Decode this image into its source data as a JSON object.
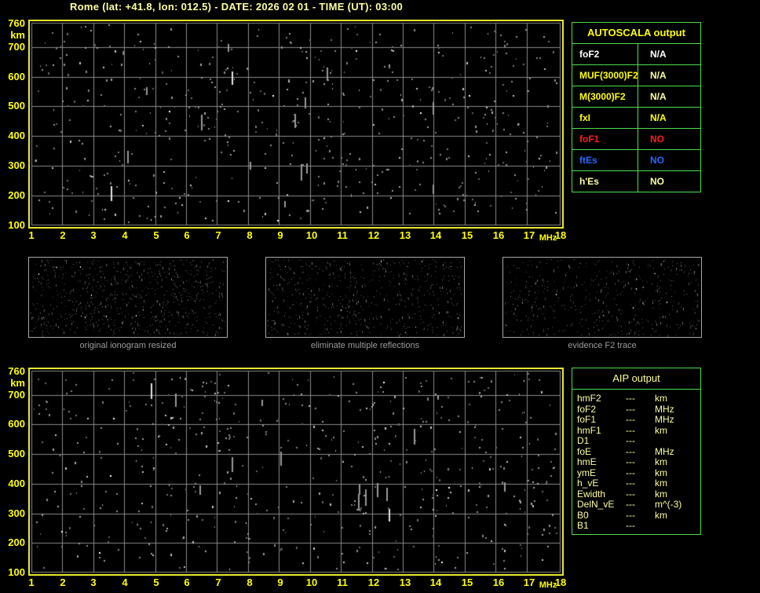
{
  "title": "Rome (lat: +41.8, lon: 012.5) - DATE: 2026 02 01 - TIME (UT): 03:00",
  "colors": {
    "background": "#000000",
    "title_text": "#ffffa0",
    "axis_frame": "#e8e832",
    "axis_label": "#ffff00",
    "grid": "#8a8a8a",
    "table_border": "#4ade4a",
    "white": "#ffffff",
    "yellow": "#ffff00",
    "pale": "#ffff9e",
    "red": "#ff1c1c",
    "blue": "#1e6aff",
    "caption_gray": "#9c9c9c"
  },
  "plots": {
    "x_ticks": [
      "1",
      "2",
      "3",
      "4",
      "5",
      "6",
      "7",
      "8",
      "9",
      "10",
      "11",
      "12",
      "13",
      "14",
      "15",
      "16",
      "17",
      "18"
    ],
    "x_unit": "MHz",
    "y_ticks": [
      "700",
      "600",
      "500",
      "400",
      "300",
      "200",
      "100"
    ],
    "y_top_tick": "760",
    "y_unit": "km"
  },
  "chart_data": [
    {
      "type": "scatter",
      "title": "ionogram (top, autoscaled input)",
      "xlabel": "MHz",
      "ylabel": "km",
      "xlim": [
        1,
        18
      ],
      "xticks": [
        1,
        2,
        3,
        4,
        5,
        6,
        7,
        8,
        9,
        10,
        11,
        12,
        13,
        14,
        15,
        16,
        17,
        18
      ],
      "ylim": [
        100,
        760
      ],
      "yticks": [
        100,
        200,
        300,
        400,
        500,
        600,
        700,
        760
      ],
      "grid": true,
      "series": [],
      "note": "only scattered background noise echoes; no ionospheric trace detected (all AUTOSCALA outputs N/A / NO)"
    },
    {
      "type": "scatter",
      "title": "ionogram (bottom, AIP stage)",
      "xlabel": "MHz",
      "ylabel": "km",
      "xlim": [
        1,
        18
      ],
      "xticks": [
        1,
        2,
        3,
        4,
        5,
        6,
        7,
        8,
        9,
        10,
        11,
        12,
        13,
        14,
        15,
        16,
        17,
        18
      ],
      "ylim": [
        100,
        760
      ],
      "yticks": [
        100,
        200,
        300,
        400,
        500,
        600,
        700,
        760
      ],
      "grid": true,
      "series": [],
      "note": "only scattered background noise echoes; no trace"
    }
  ],
  "autoscala_table": {
    "header": "AUTOSCALA output",
    "rows": [
      {
        "param": "foF2",
        "value": "N/A",
        "param_color": "white",
        "value_color": "white"
      },
      {
        "param": "MUF(3000)F2",
        "value": "N/A",
        "param_color": "yellow",
        "value_color": "pale"
      },
      {
        "param": "M(3000)F2",
        "value": "N/A",
        "param_color": "yellow",
        "value_color": "pale"
      },
      {
        "param": "fxI",
        "value": "N/A",
        "param_color": "yellow",
        "value_color": "yellow"
      },
      {
        "param": "foF1",
        "value": "NO",
        "param_color": "red",
        "value_color": "red"
      },
      {
        "param": "ftEs",
        "value": "NO",
        "param_color": "blue",
        "value_color": "blue"
      },
      {
        "param": "h'Es",
        "value": "NO",
        "param_color": "pale",
        "value_color": "pale"
      }
    ]
  },
  "thumbnails": {
    "items": [
      {
        "caption": "original ionogram resized"
      },
      {
        "caption": "eliminate multiple reflections"
      },
      {
        "caption": "evidence F2 trace"
      }
    ]
  },
  "aip_table": {
    "header": "AIP output",
    "rows": [
      {
        "param": "hmF2",
        "value": "---",
        "unit": "km"
      },
      {
        "param": "foF2",
        "value": "---",
        "unit": "MHz"
      },
      {
        "param": "foF1",
        "value": "---",
        "unit": "MHz"
      },
      {
        "param": "hmF1",
        "value": "---",
        "unit": "km"
      },
      {
        "param": "D1",
        "value": "---",
        "unit": ""
      },
      {
        "param": "foE",
        "value": "---",
        "unit": "MHz"
      },
      {
        "param": "hmE",
        "value": "---",
        "unit": "km"
      },
      {
        "param": "ymE",
        "value": "---",
        "unit": "km"
      },
      {
        "param": "h_vE",
        "value": "---",
        "unit": "km"
      },
      {
        "param": "Ewidth",
        "value": "---",
        "unit": "km"
      },
      {
        "param": "DelN_vE",
        "value": "---",
        "unit": "m^(-3)"
      },
      {
        "param": "B0",
        "value": "---",
        "unit": "km"
      },
      {
        "param": "B1",
        "value": "---",
        "unit": ""
      }
    ]
  }
}
